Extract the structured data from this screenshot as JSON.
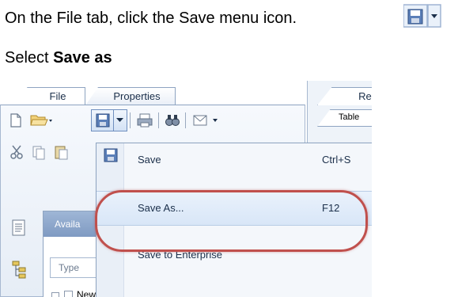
{
  "instructions": {
    "line1": "On the File tab, click the Save menu icon.",
    "line2_prefix": "Select ",
    "line2_bold": "Save as"
  },
  "tabs": {
    "file": "File",
    "properties": "Properties",
    "report": "Rep",
    "table": "Table"
  },
  "save_menu": {
    "items": [
      {
        "label": "Save",
        "shortcut": "Ctrl+S"
      },
      {
        "label": "Save As...",
        "shortcut": "F12"
      },
      {
        "label": "Save to Enterprise",
        "shortcut": ""
      }
    ]
  },
  "side_panel": {
    "header": "Availa",
    "search_placeholder": "Type",
    "tree_item": "New Document"
  },
  "colors": {
    "highlight_ring": "#c0504d",
    "panel_border": "#8ea4c1",
    "menu_hover": "#d8e6f7"
  },
  "icons": [
    "new-document-icon",
    "open-folder-icon",
    "save-icon",
    "print-icon",
    "find-icon",
    "email-icon",
    "cut-icon",
    "copy-icon",
    "paste-icon",
    "document-icon",
    "tree-structure-icon"
  ]
}
